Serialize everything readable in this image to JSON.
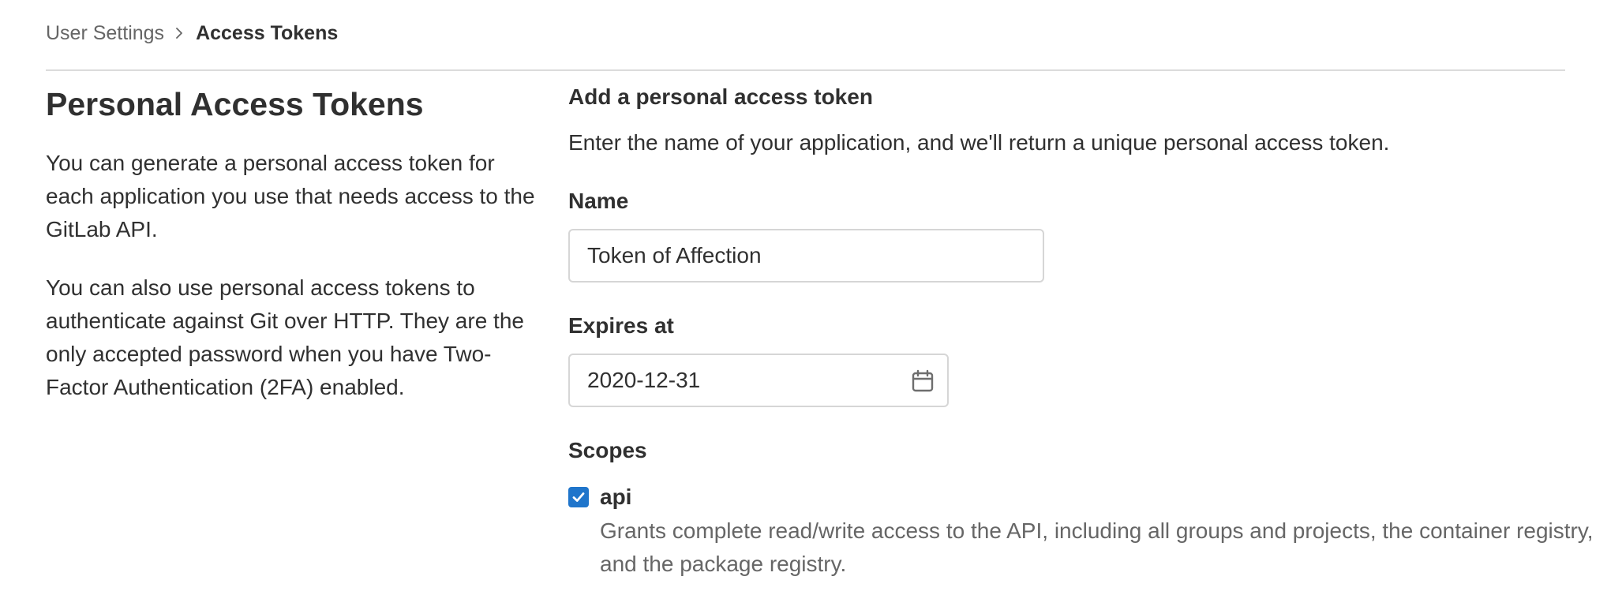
{
  "breadcrumb": {
    "parent": "User Settings",
    "current": "Access Tokens",
    "separator_icon": "chevron-right-icon"
  },
  "intro": {
    "title": "Personal Access Tokens",
    "paragraph_1": "You can generate a personal access token for each application you use that needs access to the GitLab API.",
    "paragraph_2": "You can also use personal access tokens to authenticate against Git over HTTP. They are the only accepted password when you have Two-Factor Authentication (2FA) enabled."
  },
  "form": {
    "title": "Add a personal access token",
    "help": "Enter the name of your application, and we'll return a unique personal access token.",
    "name_label": "Name",
    "name_value": "Token of Affection",
    "expires_label": "Expires at",
    "expires_value": "2020-12-31",
    "expires_icon": "calendar-icon",
    "scopes_label": "Scopes",
    "scopes": [
      {
        "name": "api",
        "checked": true,
        "description": "Grants complete read/write access to the API, including all groups and projects, the container registry, and the package registry."
      }
    ]
  },
  "colors": {
    "accent": "#1f75cb",
    "text": "#303030",
    "muted": "#666666",
    "border": "#d6d6d6"
  }
}
